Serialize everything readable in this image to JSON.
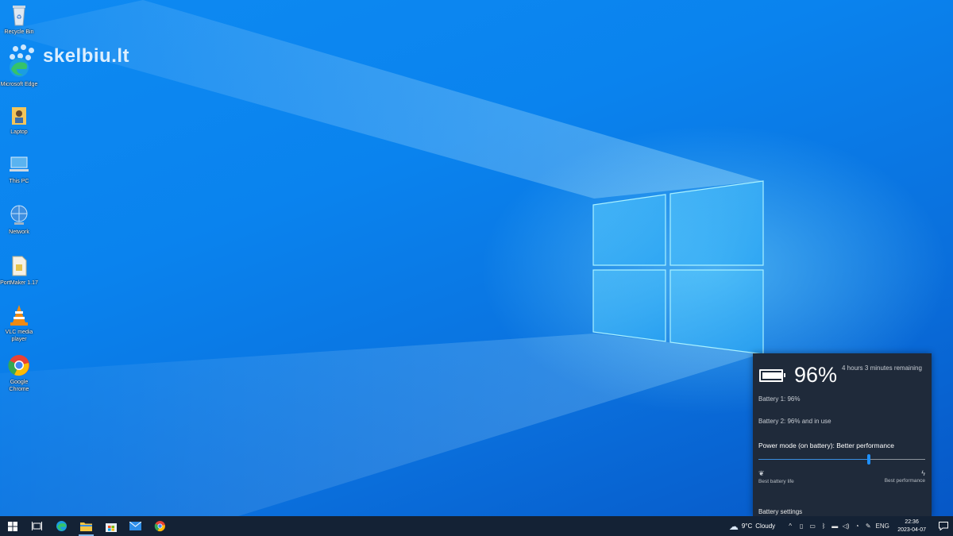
{
  "watermark": {
    "text": "skelbiu.lt"
  },
  "desktop_icons": [
    {
      "label": "Recycle Bin",
      "icon": "recycle-bin-icon"
    },
    {
      "label": "Microsoft Edge",
      "icon": "edge-icon"
    },
    {
      "label": "Laptop",
      "icon": "user-folder-icon"
    },
    {
      "label": "This PC",
      "icon": "this-pc-icon"
    },
    {
      "label": "Network",
      "icon": "network-icon"
    },
    {
      "label": "PortMaker 1.17",
      "icon": "file-icon"
    },
    {
      "label": "VLC media player",
      "icon": "vlc-icon"
    },
    {
      "label": "Google Chrome",
      "icon": "chrome-icon"
    }
  ],
  "battery_flyout": {
    "percent": "96%",
    "remaining": "4 hours 3 minutes remaining",
    "battery1": "Battery 1: 96%",
    "battery2": "Battery 2: 96% and in use",
    "power_mode_label": "Power mode (on battery): Better performance",
    "slider_level": 0.66,
    "left_end": "Best battery life",
    "right_end": "Best performance",
    "settings_link": "Battery settings"
  },
  "taskbar": {
    "pinned": [
      "start-icon",
      "task-view-icon",
      "edge-icon",
      "file-explorer-icon",
      "store-icon",
      "mail-icon",
      "chrome-icon"
    ],
    "weather": {
      "temp": "9°C",
      "condition": "Cloudy"
    },
    "language": "ENG",
    "time": "22:36",
    "date": "2023-04-07"
  },
  "colors": {
    "accent": "#1e90ff",
    "taskbar": "#142235",
    "flyout": "#1f2a3a"
  }
}
